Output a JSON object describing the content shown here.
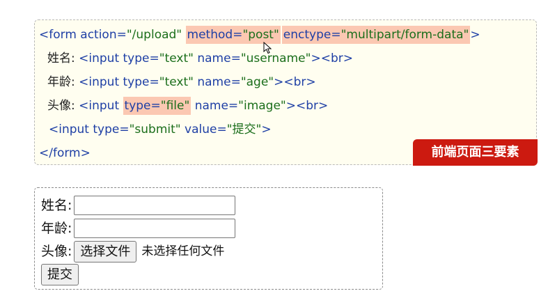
{
  "code": {
    "line1": {
      "open": "<form action=",
      "action_val": "\"/upload\"",
      "method_attr": "method=",
      "method_val": "\"post\"",
      "enctype_attr": "enctype=",
      "enctype_val": "\"multipart/form-data\"",
      "close": ">"
    },
    "line2": {
      "label": "姓名: ",
      "open": "<input type=",
      "type_val": "\"text\"",
      "name_attr": " name=",
      "name_val": "\"username\"",
      "close": "><br>"
    },
    "line3": {
      "label": "年龄: ",
      "open": "<input type=",
      "type_val": "\"text\"",
      "name_attr": " name=",
      "name_val": "\"age\"",
      "close": "><br>"
    },
    "line4": {
      "label": "头像: ",
      "open": "<input ",
      "type_attr": "type=",
      "type_val": "\"file\"",
      "name_attr": " name=",
      "name_val": "\"image\"",
      "close": "><br>"
    },
    "line5": {
      "open": "<input type=",
      "type_val": "\"submit\"",
      "value_attr": " value=",
      "value_val": "\"提交\"",
      "close": ">"
    },
    "line6": {
      "close": "</form>"
    },
    "badge": "前端页面三要素"
  },
  "form": {
    "username_label": "姓名:",
    "age_label": "年龄:",
    "image_label": "头像:",
    "file_button": "选择文件",
    "file_status": "未选择任何文件",
    "submit_label": "提交"
  },
  "colors": {
    "highlight": "#fbc8b2",
    "badge": "#cc1a10",
    "tag": "#1e3fa5",
    "value": "#1b6e1b"
  }
}
